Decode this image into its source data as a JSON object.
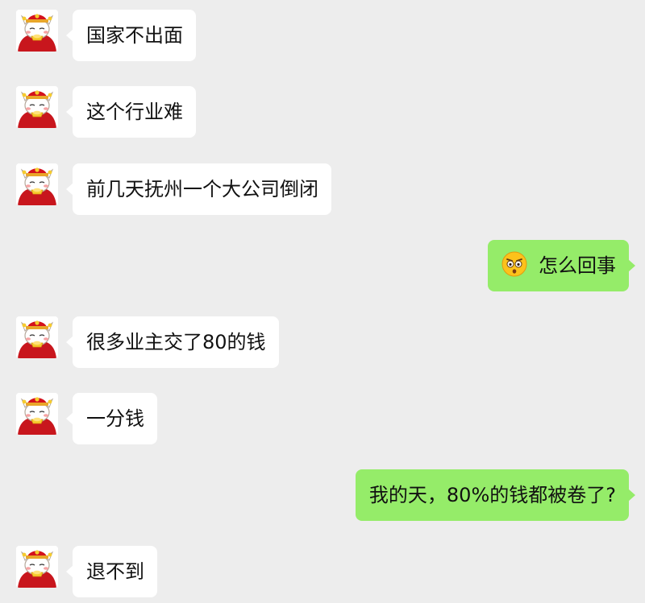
{
  "messages": [
    {
      "side": "in",
      "text": "国家不出面"
    },
    {
      "side": "in",
      "text": "这个行业难"
    },
    {
      "side": "in",
      "text": "前几天抚州一个大公司倒闭"
    },
    {
      "side": "out",
      "emoji": "shocked-face-icon",
      "text": "怎么回事"
    },
    {
      "side": "in",
      "text": "很多业主交了80的钱"
    },
    {
      "side": "in",
      "text": "一分钱"
    },
    {
      "side": "out",
      "text": "我的天，80%的钱都被卷了?"
    },
    {
      "side": "in",
      "text": "退不到"
    }
  ],
  "colors": {
    "background": "#ededed",
    "incoming_bubble": "#ffffff",
    "outgoing_bubble": "#95ec69",
    "text": "#111111",
    "avatar_robe": "#c8161d",
    "avatar_hat": "#d4111b"
  }
}
